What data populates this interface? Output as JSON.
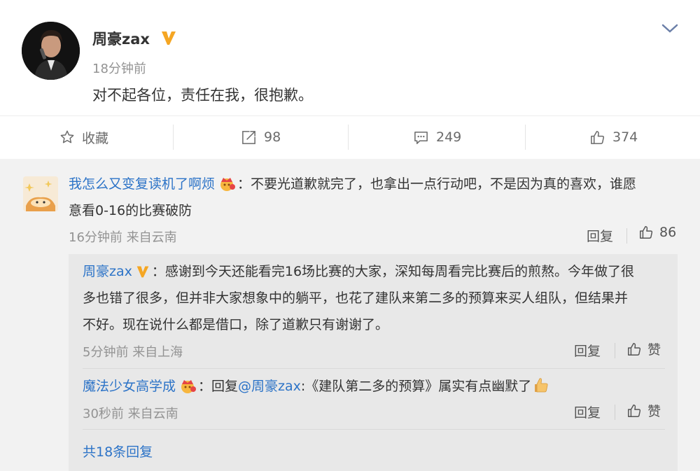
{
  "post": {
    "author": "周豪zax",
    "time": "18分钟前",
    "text": "对不起各位，责任在我，很抱歉。"
  },
  "actions": {
    "favorite": "收藏",
    "repost": "98",
    "comment": "249",
    "like": "374"
  },
  "comment1": {
    "user": "我怎么又变复读机了啊烦",
    "text_line1": "：不要光道歉就完了，也拿出一点行动吧，不是因为真的喜欢，谁愿",
    "text_line2": "意看0-16的比赛破防",
    "time": "16分钟前",
    "location": "来自云南",
    "reply_label": "回复",
    "likes": "86"
  },
  "replies": [
    {
      "user": "周豪zax",
      "line1": "：感谢到今天还能看完16场比赛的大家，深知每周看完比赛后的煎熬。今年做了很",
      "line2": "多也错了很多，但并非大家想象中的躺平，也花了建队来第二多的预算来买人组队，但结果并",
      "line3": "不好。现在说什么都是借口，除了道歉只有谢谢了。",
      "time": "5分钟前",
      "location": "来自上海",
      "reply_label": "回复",
      "like_label": "赞"
    },
    {
      "user": "魔法少女高学成",
      "prefix": "：回复",
      "mention": "@周豪zax",
      "text": ":《建队第二多的预算》属实有点幽默了",
      "time": "30秒前",
      "location": "来自云南",
      "reply_label": "回复",
      "like_label": "赞"
    }
  ],
  "more_replies": "共18条回复",
  "colors": {
    "link": "#2c73c7",
    "vip_badge": "#f5a623",
    "gray_text": "#939393"
  }
}
